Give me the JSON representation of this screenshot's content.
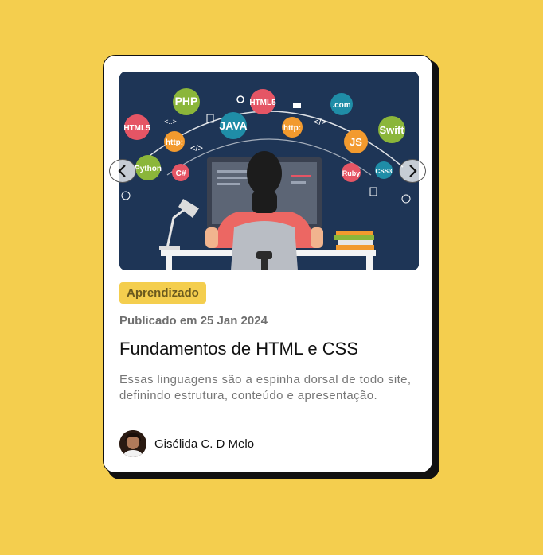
{
  "card": {
    "image_alt": "Ilustração de programador com tecnologias web",
    "image_badges": [
      "PHP",
      "HTML5",
      "HTML5",
      "JAVA",
      "http:",
      ".com",
      "Swift",
      "JS",
      "Python",
      "C#",
      "http:",
      "Ruby",
      "CSS3",
      "</>",
      "<..>",
      "</>"
    ],
    "tag": "Aprendizado",
    "published": "Publicado em 25 Jan 2024",
    "title": "Fundamentos de HTML e CSS",
    "description": "Essas linguagens são a espinha dorsal de todo site, definindo estrutura, conteúdo e apresentação.",
    "author": "Gisélida C. D Melo"
  },
  "colors": {
    "background": "#F4CE4E",
    "card": "#FFFFFF",
    "hero_bg": "#1E3556",
    "tag_bg": "#F4CE4E"
  }
}
